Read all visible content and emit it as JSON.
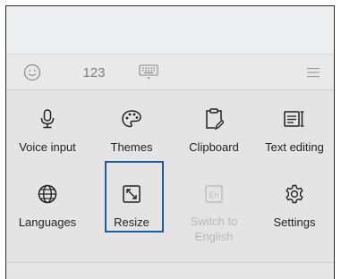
{
  "toolbar": {
    "emoji_icon": "smiley-icon",
    "numbers_label": "123",
    "keyboard_icon": "keyboard-icon",
    "menu_icon": "hamburger-icon"
  },
  "menu": {
    "items": [
      {
        "label": "Voice input",
        "icon": "microphone-icon",
        "enabled": true
      },
      {
        "label": "Themes",
        "icon": "palette-icon",
        "enabled": true
      },
      {
        "label": "Clipboard",
        "icon": "clipboard-icon",
        "enabled": true
      },
      {
        "label": "Text editing",
        "icon": "text-editing-icon",
        "enabled": true
      },
      {
        "label": "Languages",
        "icon": "globe-icon",
        "enabled": true
      },
      {
        "label": "Resize",
        "icon": "resize-icon",
        "enabled": true,
        "highlighted": true
      },
      {
        "label": "Switch to English",
        "label_line1": "Switch to",
        "label_line2": "English",
        "icon": "en-icon",
        "enabled": false
      },
      {
        "label": "Settings",
        "icon": "gear-icon",
        "enabled": true
      }
    ]
  },
  "colors": {
    "highlight_border": "#1f5c9e",
    "text": "#222222",
    "disabled_text": "#b8b8b8"
  }
}
